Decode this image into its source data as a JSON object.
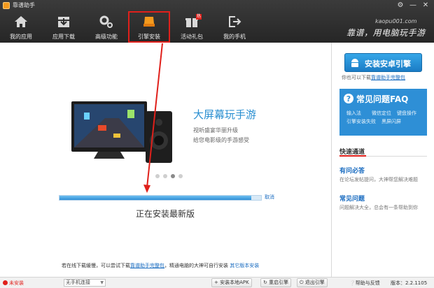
{
  "window": {
    "title": "靠谱助手",
    "controls": [
      "⚙",
      "—",
      "✕"
    ]
  },
  "nav": {
    "items": [
      {
        "label": "我的应用",
        "icon": "home-icon"
      },
      {
        "label": "应用下载",
        "icon": "download-icon"
      },
      {
        "label": "高级功能",
        "icon": "gear-icon"
      },
      {
        "label": "引擎安装",
        "icon": "engine-icon"
      },
      {
        "label": "活动礼包",
        "icon": "gift-icon",
        "badge": "热"
      },
      {
        "label": "我的手机",
        "icon": "logout-icon"
      }
    ],
    "active_index": 3
  },
  "header": {
    "url": "kaopu001.com",
    "slogan": "靠谱，用电脑玩手游"
  },
  "main": {
    "banner_title": "大屏幕玩手游",
    "banner_sub_1": "视听盛宴华丽升级",
    "banner_sub_2": "给您电影级的手游感受",
    "dots_count": 4,
    "dots_active": 2,
    "progress": 0.95,
    "cancel": "取消",
    "status": "正在安装最新版",
    "hint_prefix": "若在线下载缓慢，可以尝试下载",
    "hint_link": "靠谱助手完整包",
    "hint_middle": "，精通电脑的大神可自行安装",
    "hint_link2": "其它版本安装"
  },
  "sidebar": {
    "install_button": "安装安卓引擎",
    "side_hint_prefix": "你也可以下载",
    "side_hint_link": "靠谱助手完整包",
    "faq_title": "常见问题FAQ",
    "faq_links": [
      "输入法",
      "微信定位",
      "键盘操作",
      "引擎安装失败",
      "黑屏闪屏"
    ],
    "quick_title": "快速通道",
    "qa1_head": "有问必答",
    "qa1_sub": "在论坛发帖提问，大神帮您解决难题",
    "qa2_head": "常见问题",
    "qa2_sub": "问题解决大全，总会有一条帮助到你"
  },
  "statusbar": {
    "status": "未安装",
    "connect": "无手机连接",
    "btn_apk": "安装本地APK",
    "btn_restart": "重启引擎",
    "btn_exit": "退出引擎",
    "help": "帮助与反馈",
    "version_label": "版本：",
    "version": "2.2.1105"
  },
  "colors": {
    "accent": "#2e8fd6",
    "highlight": "#e0201b",
    "toolbar": "#2e2e2e"
  }
}
